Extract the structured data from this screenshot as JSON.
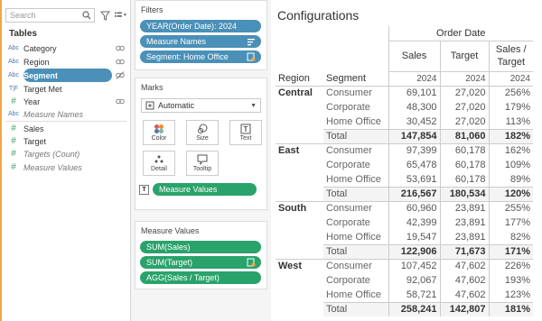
{
  "data_pane": {
    "search_placeholder": "Search",
    "tables_title": "Tables",
    "fields": [
      {
        "type": "Abc",
        "name": "Category"
      },
      {
        "type": "Abc",
        "name": "Region"
      },
      {
        "type": "Abc",
        "name": "Segment"
      },
      {
        "type": "T|F",
        "name": "Target Met"
      },
      {
        "type": "#",
        "name": "Year"
      },
      {
        "type": "Abc",
        "name": "Measure Names"
      },
      {
        "type": "#",
        "name": "Sales"
      },
      {
        "type": "#",
        "name": "Target"
      },
      {
        "type": "#",
        "name": "Targets (Count)"
      },
      {
        "type": "#",
        "name": "Measure Values"
      }
    ]
  },
  "filters": {
    "title": "Filters",
    "items": [
      "YEAR(Order Date): 2024",
      "Measure Names",
      "Segment: Home Office"
    ]
  },
  "marks": {
    "title": "Marks",
    "type": "Automatic",
    "buttons": [
      "Color",
      "Size",
      "Text",
      "Detail",
      "Tooltip"
    ],
    "text_pill": "Measure Values"
  },
  "measure_values": {
    "title": "Measure Values",
    "items": [
      "SUM(Sales)",
      "SUM(Target)",
      "AGG(Sales / Target)"
    ]
  },
  "view": {
    "title": "Configurations",
    "column_group": "Order Date",
    "headers": [
      "Sales",
      "Target",
      "Sales /\nTarget"
    ],
    "year": "2024",
    "row_header": "Region",
    "seg_header": "Segment",
    "regions": [
      {
        "name": "Central",
        "rows": [
          {
            "segment": "Consumer",
            "sales": "69,101",
            "target": "27,020",
            "ratio": "256%"
          },
          {
            "segment": "Corporate",
            "sales": "48,300",
            "target": "27,020",
            "ratio": "179%"
          },
          {
            "segment": "Home Office",
            "sales": "30,452",
            "target": "27,020",
            "ratio": "113%"
          },
          {
            "segment": "Total",
            "sales": "147,854",
            "target": "81,060",
            "ratio": "182%"
          }
        ]
      },
      {
        "name": "East",
        "rows": [
          {
            "segment": "Consumer",
            "sales": "97,399",
            "target": "60,178",
            "ratio": "162%"
          },
          {
            "segment": "Corporate",
            "sales": "65,478",
            "target": "60,178",
            "ratio": "109%"
          },
          {
            "segment": "Home Office",
            "sales": "53,691",
            "target": "60,178",
            "ratio": "89%"
          },
          {
            "segment": "Total",
            "sales": "216,567",
            "target": "180,534",
            "ratio": "120%"
          }
        ]
      },
      {
        "name": "South",
        "rows": [
          {
            "segment": "Consumer",
            "sales": "60,960",
            "target": "23,891",
            "ratio": "255%"
          },
          {
            "segment": "Corporate",
            "sales": "42,399",
            "target": "23,891",
            "ratio": "177%"
          },
          {
            "segment": "Home Office",
            "sales": "19,547",
            "target": "23,891",
            "ratio": "82%"
          },
          {
            "segment": "Total",
            "sales": "122,906",
            "target": "71,673",
            "ratio": "171%"
          }
        ]
      },
      {
        "name": "West",
        "rows": [
          {
            "segment": "Consumer",
            "sales": "107,452",
            "target": "47,602",
            "ratio": "226%"
          },
          {
            "segment": "Corporate",
            "sales": "92,067",
            "target": "47,602",
            "ratio": "193%"
          },
          {
            "segment": "Home Office",
            "sales": "58,721",
            "target": "47,602",
            "ratio": "123%"
          },
          {
            "segment": "Total",
            "sales": "258,241",
            "target": "142,807",
            "ratio": "181%"
          }
        ]
      }
    ]
  },
  "colors": {
    "accent_orange": "#f0a64a",
    "pill_blue": "#4a90b8",
    "pill_green": "#29a36b"
  }
}
